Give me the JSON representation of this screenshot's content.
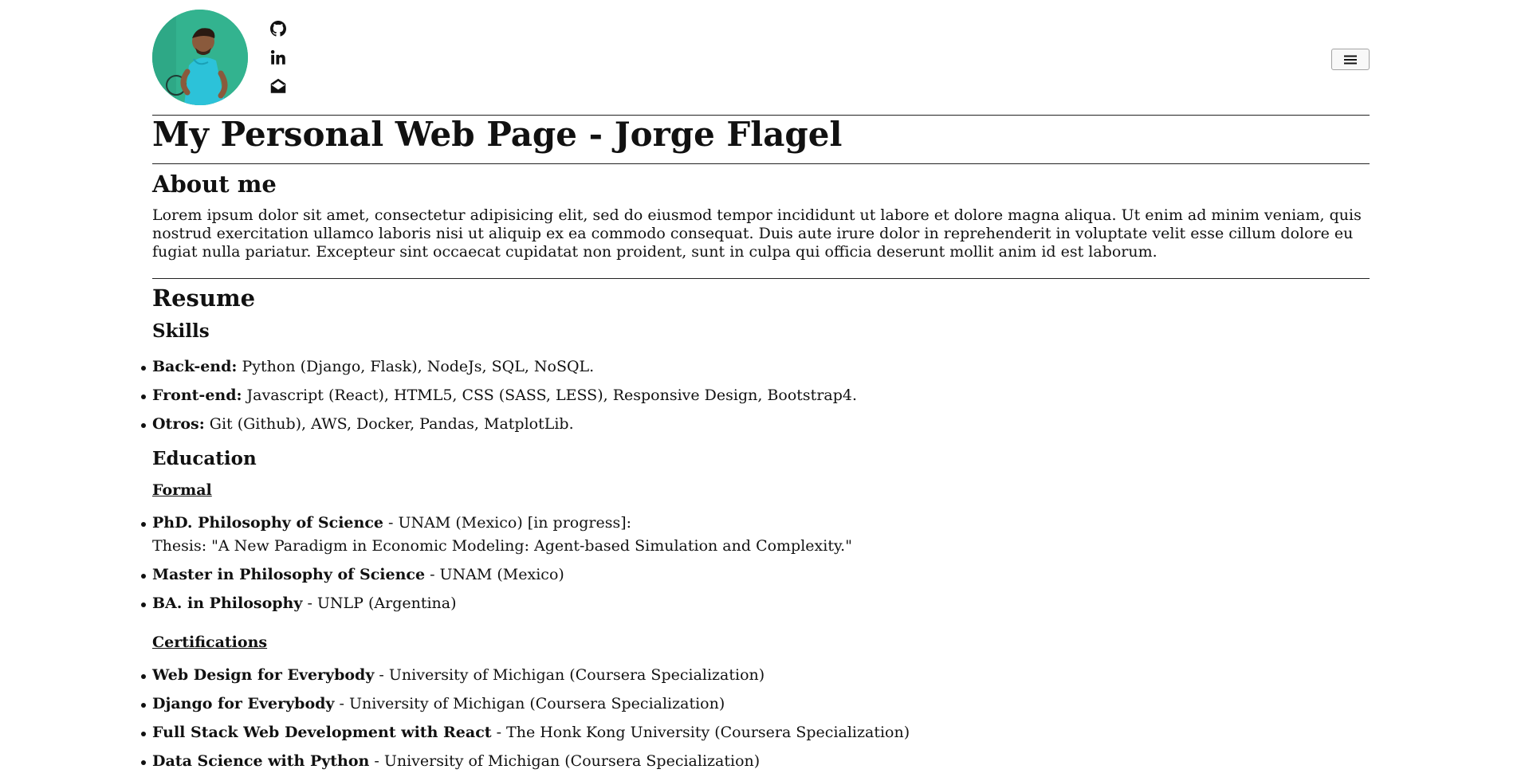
{
  "header": {
    "avatar_alt": "Jorge Flagel",
    "social_icons": [
      "github-icon",
      "linkedin-icon",
      "envelope-open-icon"
    ],
    "menu_icon": "hamburger-icon"
  },
  "title": "My Personal Web Page - Jorge Flagel",
  "about": {
    "heading": "About me",
    "text": "Lorem ipsum dolor sit amet, consectetur adipisicing elit, sed do eiusmod tempor incididunt ut labore et dolore magna aliqua. Ut enim ad minim veniam, quis nostrud exercitation ullamco laboris nisi ut aliquip ex ea commodo consequat. Duis aute irure dolor in reprehenderit in voluptate velit esse cillum dolore eu fugiat nulla pariatur. Excepteur sint occaecat cupidatat non proident, sunt in culpa qui officia deserunt mollit anim id est laborum."
  },
  "resume": {
    "heading": "Resume",
    "skills": {
      "heading": "Skills",
      "items": [
        {
          "label": "Back-end:",
          "text": " Python (Django, Flask), NodeJs, SQL, NoSQL."
        },
        {
          "label": "Front-end:",
          "text": " Javascript (React), HTML5, CSS (SASS, LESS), Responsive Design, Bootstrap4."
        },
        {
          "label": "Otros:",
          "text": " Git (Github), AWS, Docker, Pandas, MatplotLib."
        }
      ]
    },
    "education": {
      "heading": "Education",
      "formal_heading": "Formal",
      "formal": [
        {
          "label": "PhD. Philosophy of Science",
          "text": " - UNAM (Mexico) [in progress]:",
          "thesis": "Thesis: \"A New Paradigm in Economic Modeling: Agent-based Simulation and Complexity.\""
        },
        {
          "label": "Master in Philosophy of Science",
          "text": " - UNAM (Mexico)"
        },
        {
          "label": "BA. in Philosophy",
          "text": " - UNLP (Argentina)"
        }
      ],
      "certifications_heading": "Certifications",
      "certifications": [
        {
          "label": "Web Design for Everybody",
          "text": " - University of Michigan (Coursera Specialization)"
        },
        {
          "label": "Django for Everybody",
          "text": " - University of Michigan (Coursera Specialization)"
        },
        {
          "label": "Full Stack Web Development with React",
          "text": " - The Honk Kong University (Coursera Specialization)"
        },
        {
          "label": "Data Science with Python",
          "text": " - University of Michigan (Coursera Specialization)"
        }
      ]
    }
  }
}
